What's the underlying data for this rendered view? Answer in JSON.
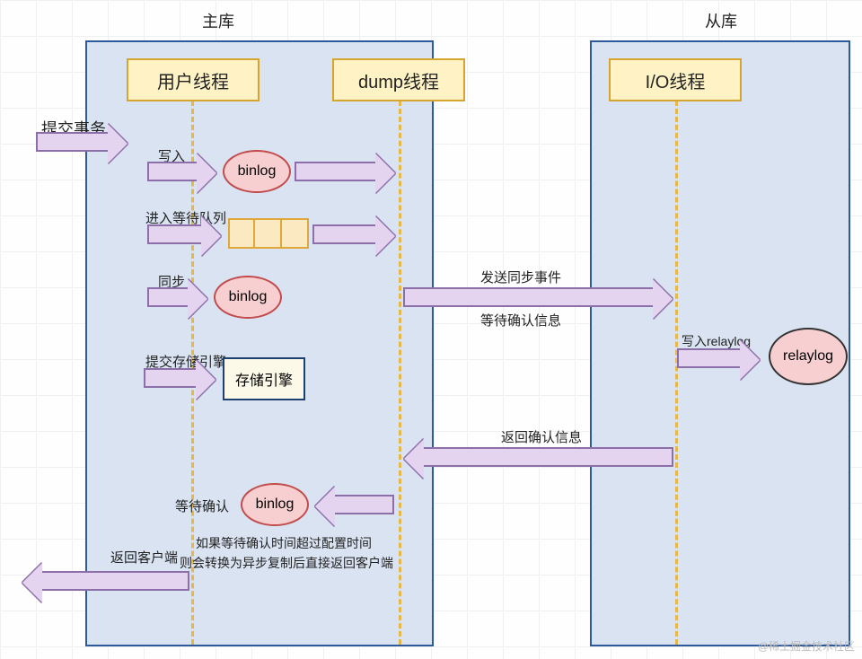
{
  "titles": {
    "master": "主库",
    "slave": "从库"
  },
  "actors": {
    "user": "用户线程",
    "dump": "dump线程",
    "io": "I/O线程"
  },
  "nodes": {
    "binlog1": "binlog",
    "binlog2": "binlog",
    "binlog3": "binlog",
    "storage": "存储引擎",
    "relaylog": "relaylog"
  },
  "labels": {
    "submit_tx": "提交事务",
    "write": "写入",
    "enter_queue": "进入等待队列",
    "sync": "同步",
    "commit_engine": "提交存储引擎",
    "send_sync": "发送同步事件",
    "wait_ack": "等待确认信息",
    "write_relay": "写入relaylog",
    "return_ack": "返回确认信息",
    "wait_confirm": "等待确认",
    "return_client": "返回客户端"
  },
  "note": {
    "line1": "如果等待确认时间超过配置时间",
    "line2": "则会转换为异步复制后直接返回客户端"
  },
  "watermark": "@稀土掘金技术社区"
}
